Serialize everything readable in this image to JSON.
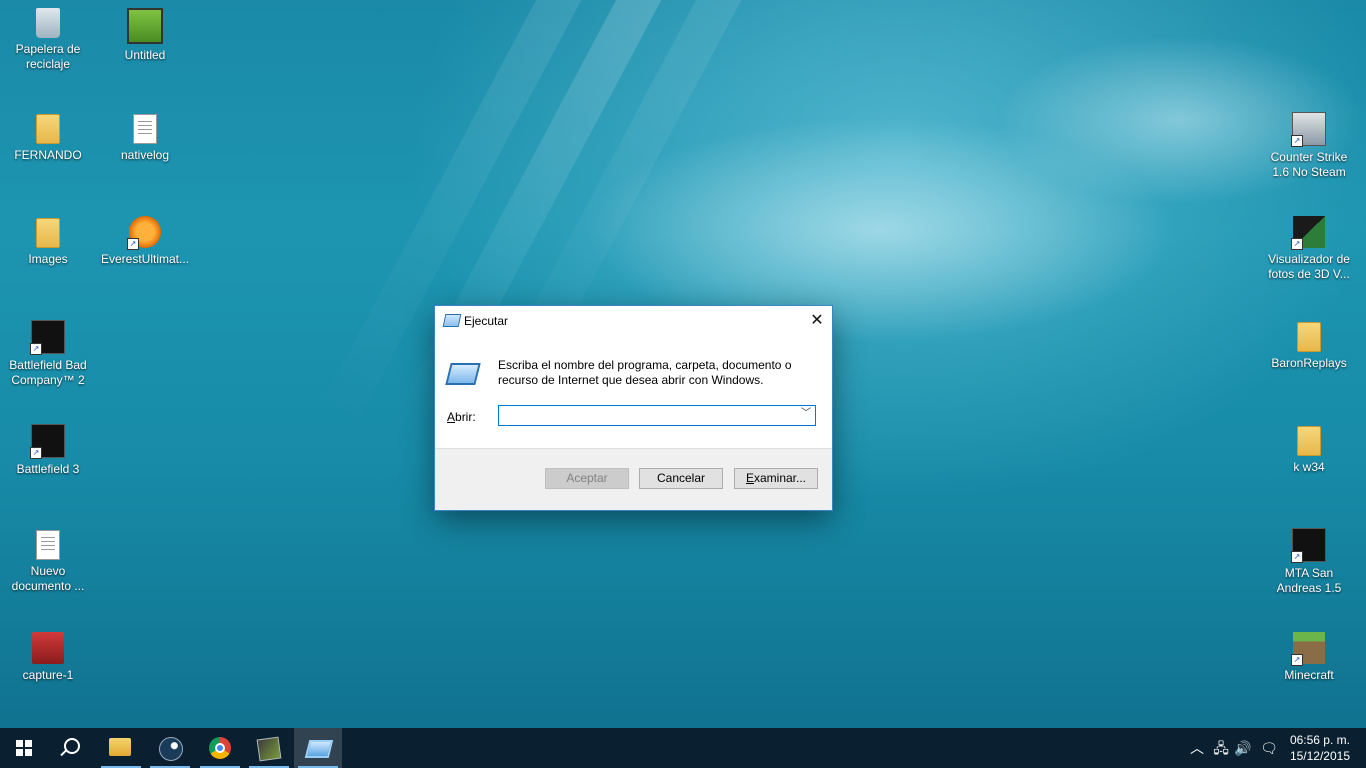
{
  "desktop": {
    "icons": [
      {
        "label": "Papelera de reciclaje",
        "icon": "recycle-bin-icon"
      },
      {
        "label": "Untitled",
        "icon": "video-file-icon"
      },
      {
        "label": "FERNANDO",
        "icon": "folder-icon"
      },
      {
        "label": "nativelog",
        "icon": "text-file-icon"
      },
      {
        "label": "Images",
        "icon": "folder-icon"
      },
      {
        "label": "EverestUltimat...",
        "icon": "everest-icon"
      },
      {
        "label": "Battlefield Bad Company™ 2",
        "icon": "game-shortcut-icon"
      },
      {
        "label": "Battlefield 3",
        "icon": "game-shortcut-icon"
      },
      {
        "label": "Nuevo documento ...",
        "icon": "text-file-icon"
      },
      {
        "label": "capture-1",
        "icon": "video-file-icon"
      },
      {
        "label": "Counter Strike 1.6 No Steam",
        "icon": "game-shortcut-icon"
      },
      {
        "label": "Visualizador de fotos de 3D V...",
        "icon": "app-shortcut-icon"
      },
      {
        "label": "BaronReplays",
        "icon": "folder-icon"
      },
      {
        "label": "k w34",
        "icon": "folder-icon"
      },
      {
        "label": "MTA San Andreas 1.5",
        "icon": "game-shortcut-icon"
      },
      {
        "label": "Minecraft",
        "icon": "minecraft-icon"
      }
    ]
  },
  "dialog": {
    "title": "Ejecutar",
    "description": "Escriba el nombre del programa, carpeta, documento o recurso de Internet que desea abrir con Windows.",
    "open_label_mnemonic": "A",
    "open_label_rest": "brir:",
    "open_value": "",
    "ok_label": "Aceptar",
    "cancel_label": "Cancelar",
    "browse_label_mnemonic": "E",
    "browse_label_rest": "xaminar...",
    "close_glyph": "✕"
  },
  "taskbar": {
    "items": [
      "start",
      "search",
      "file-explorer",
      "steam",
      "chrome",
      "nvidia",
      "run"
    ],
    "tray": {
      "time": "06:56 p. m.",
      "date": "15/12/2015"
    }
  },
  "colors": {
    "accent": "#0078d7",
    "taskbar": "#0a1928"
  }
}
